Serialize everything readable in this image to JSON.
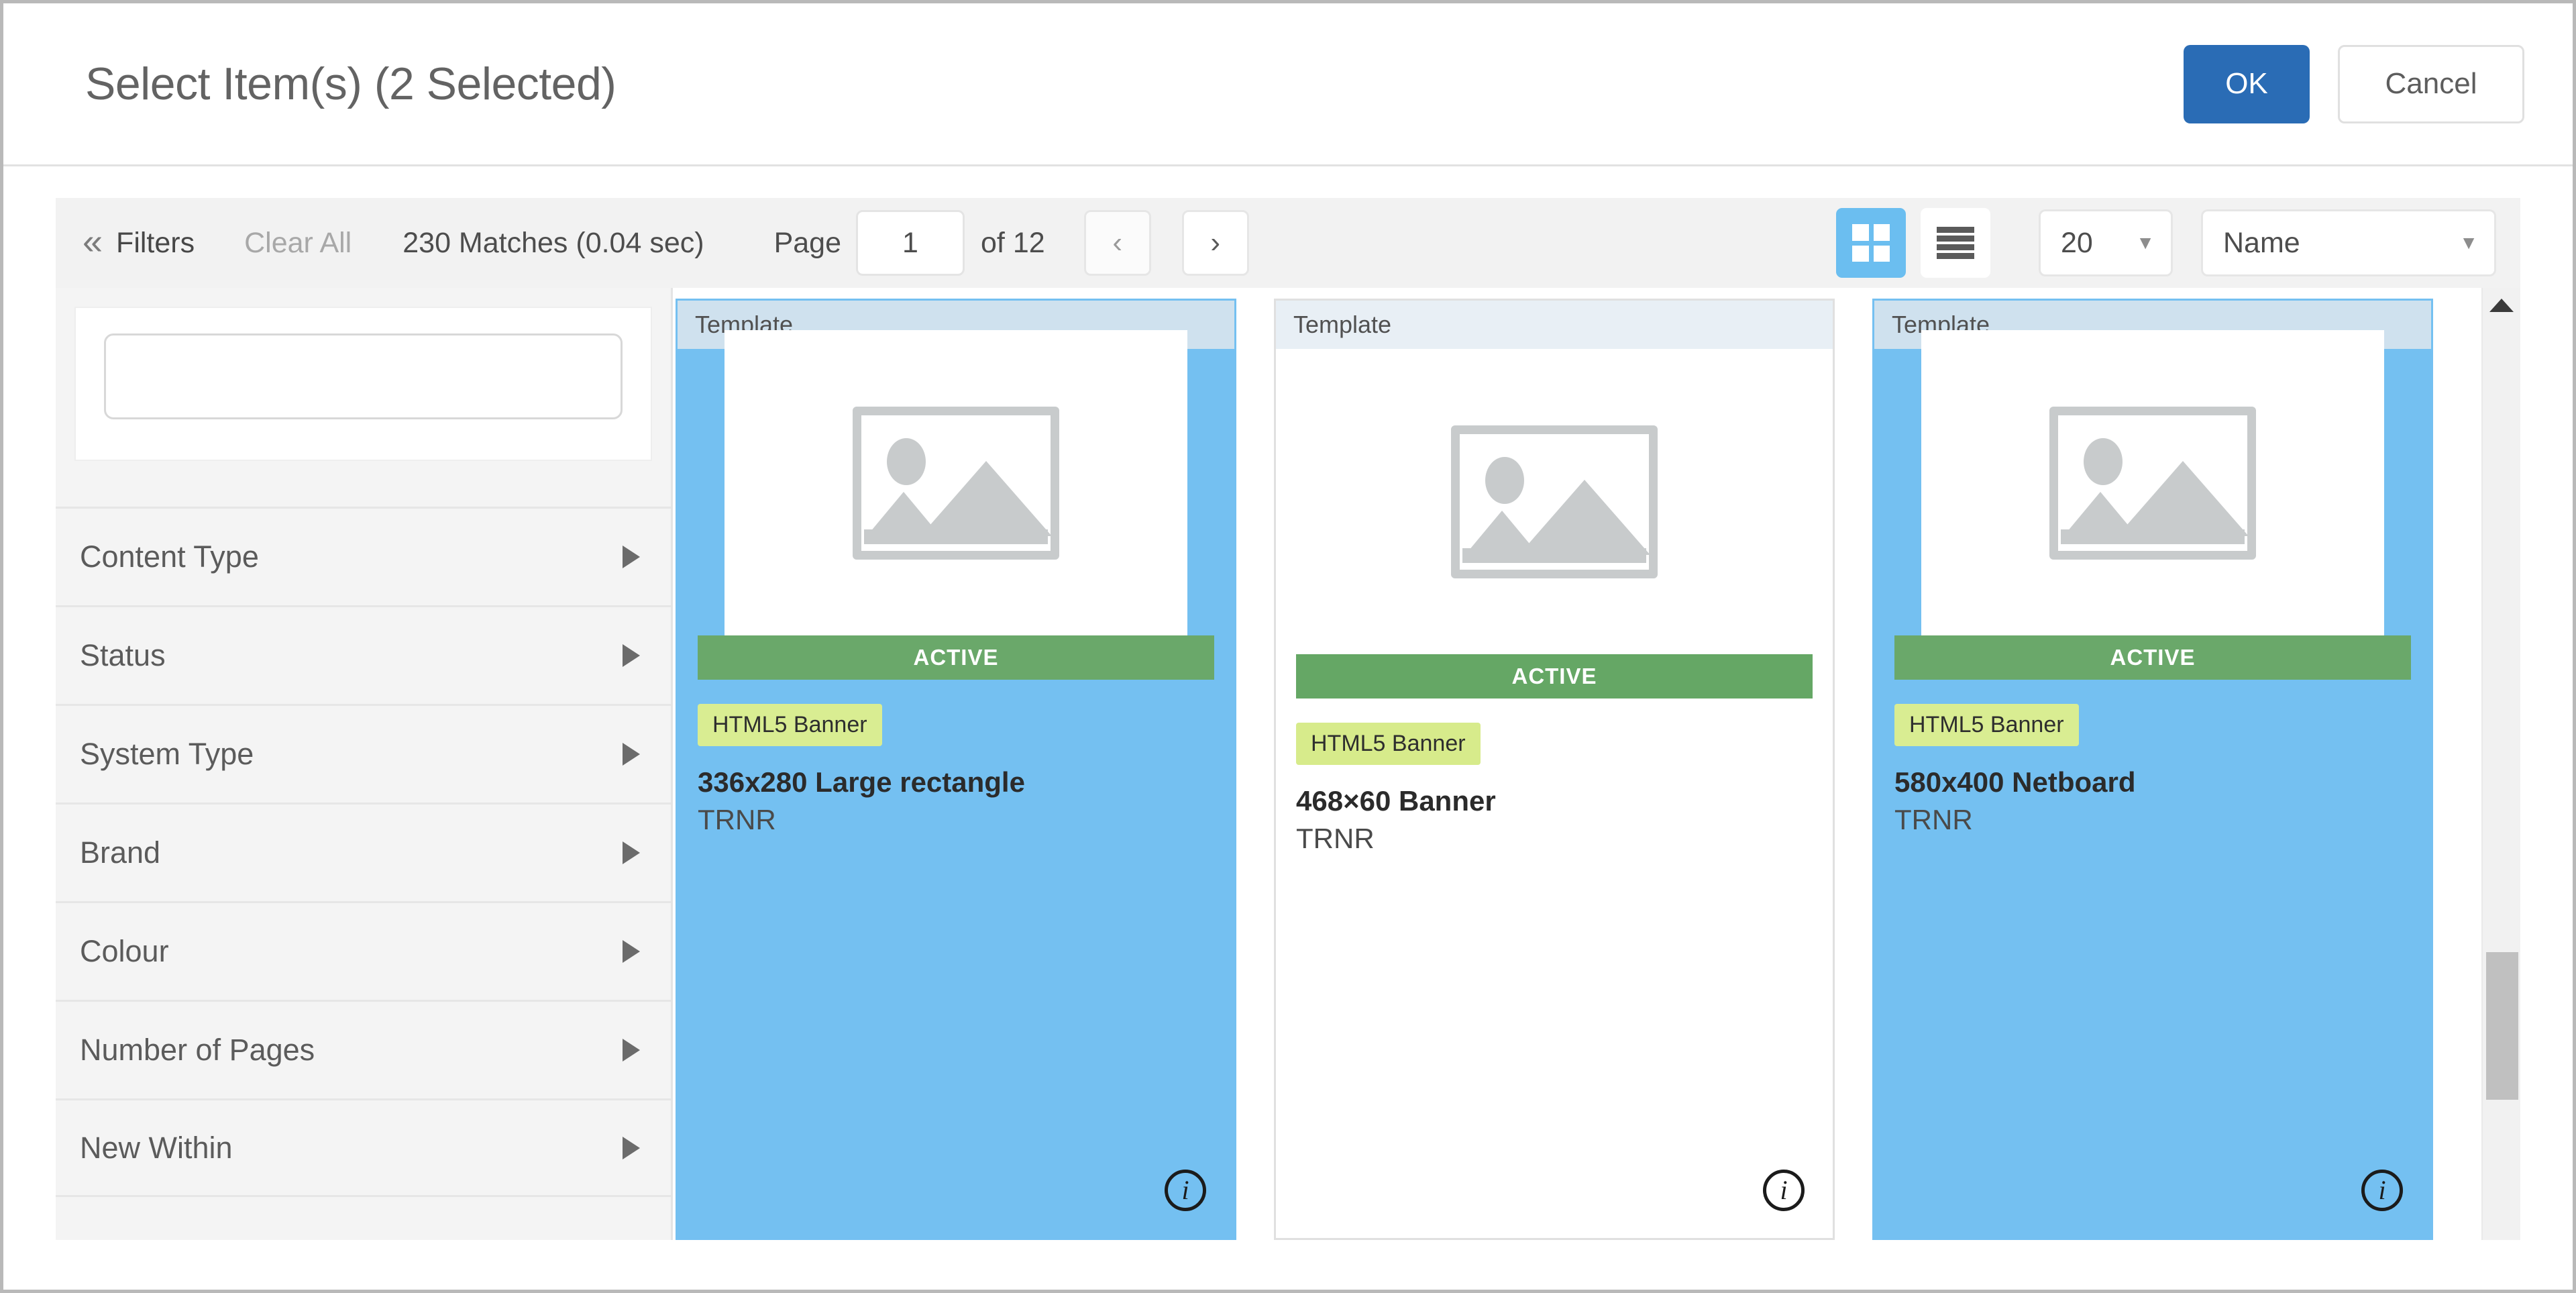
{
  "dialog": {
    "title": "Select Item(s) (2 Selected)",
    "ok_label": "OK",
    "cancel_label": "Cancel"
  },
  "toolbar": {
    "collapse_icon": "chevron-left-double-icon",
    "filters_label": "Filters",
    "clear_all_label": "Clear All",
    "matches_text": "230 Matches (0.04 sec)",
    "page_label": "Page",
    "page_value": "1",
    "of_pages_text": "of 12",
    "prev_glyph": "‹",
    "next_glyph": "›",
    "grid_view_icon": "grid-view-icon",
    "list_view_icon": "list-view-icon",
    "page_size_value": "20",
    "sort_value": "Name",
    "caret_glyph": "▼"
  },
  "sidebar": {
    "search_value": "",
    "search_placeholder": "",
    "filters": [
      {
        "label": "Content Type"
      },
      {
        "label": "Status"
      },
      {
        "label": "System Type"
      },
      {
        "label": "Brand"
      },
      {
        "label": "Colour"
      },
      {
        "label": "Number of Pages"
      },
      {
        "label": "New Within"
      }
    ]
  },
  "results": {
    "cards": [
      {
        "type_label": "Template",
        "status": "ACTIVE",
        "tag": "HTML5 Banner",
        "title": "336x280 Large rectangle",
        "subtitle": "TRNR",
        "selected": true,
        "info_glyph": "i"
      },
      {
        "type_label": "Template",
        "status": "ACTIVE",
        "tag": "HTML5 Banner",
        "title": "468×60 Banner",
        "subtitle": "TRNR",
        "selected": false,
        "info_glyph": "i"
      },
      {
        "type_label": "Template",
        "status": "ACTIVE",
        "tag": "HTML5 Banner",
        "title": "580x400 Netboard",
        "subtitle": "TRNR",
        "selected": true,
        "info_glyph": "i"
      }
    ]
  },
  "colors": {
    "primary_button": "#2a6cb5",
    "selected_card": "#74c0f1",
    "active_status": "#65a765",
    "tag_background": "#d7eb8b",
    "toolbar_background": "#f2f2f2"
  }
}
